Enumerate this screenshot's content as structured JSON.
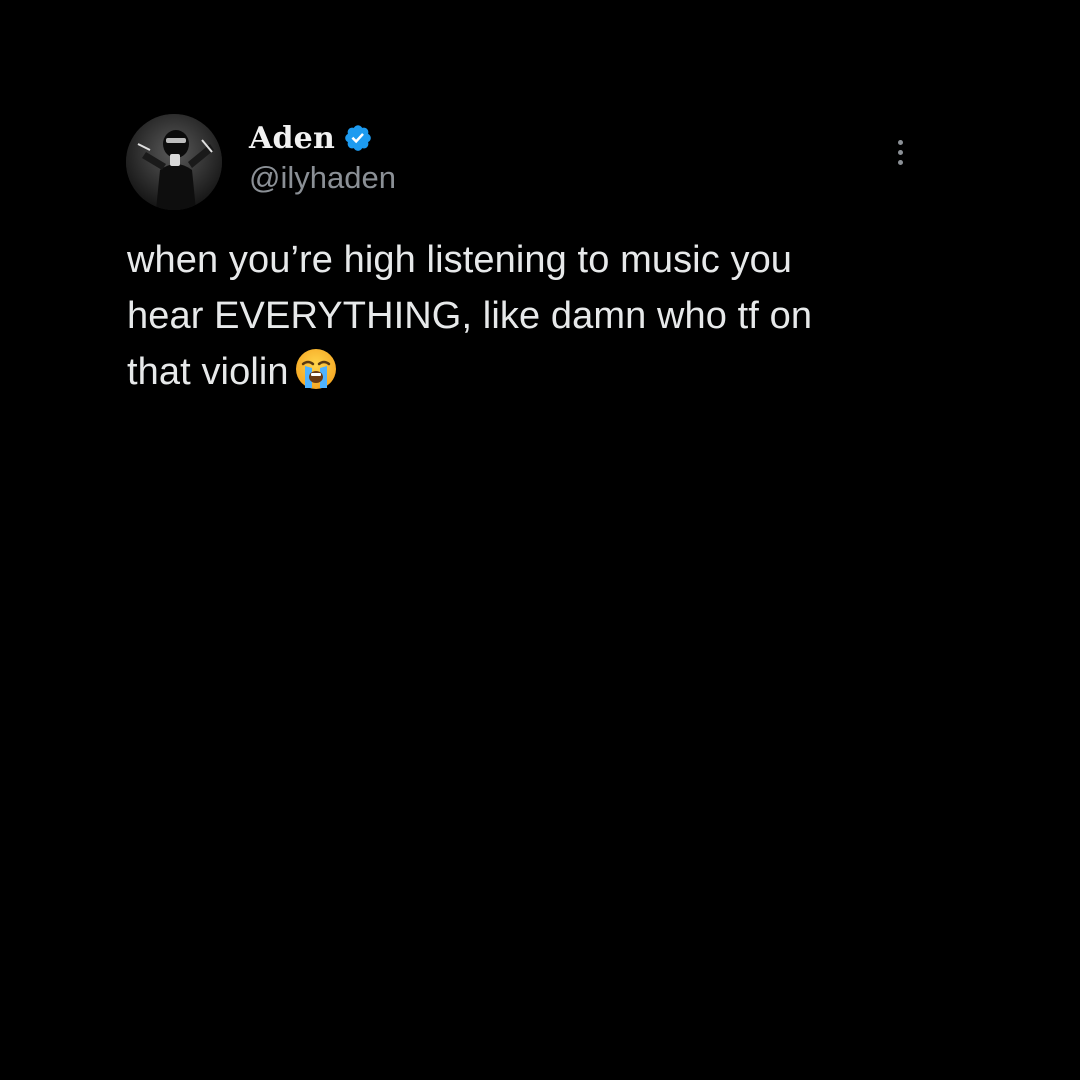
{
  "author": {
    "display_name": "Aden",
    "handle": "@ilyhaden",
    "verified": true,
    "verified_color": "#1d9bf0"
  },
  "tweet": {
    "lines": [
      "when you’re high listening to music you",
      "hear EVERYTHING, like damn who tf on",
      "that violin"
    ],
    "trailing_emoji": "loudly-crying-face"
  },
  "menu": {
    "icon": "more-vertical-icon"
  },
  "colors": {
    "background": "#000000",
    "text": "#e7e9ea",
    "secondary_text": "#8b9096"
  }
}
